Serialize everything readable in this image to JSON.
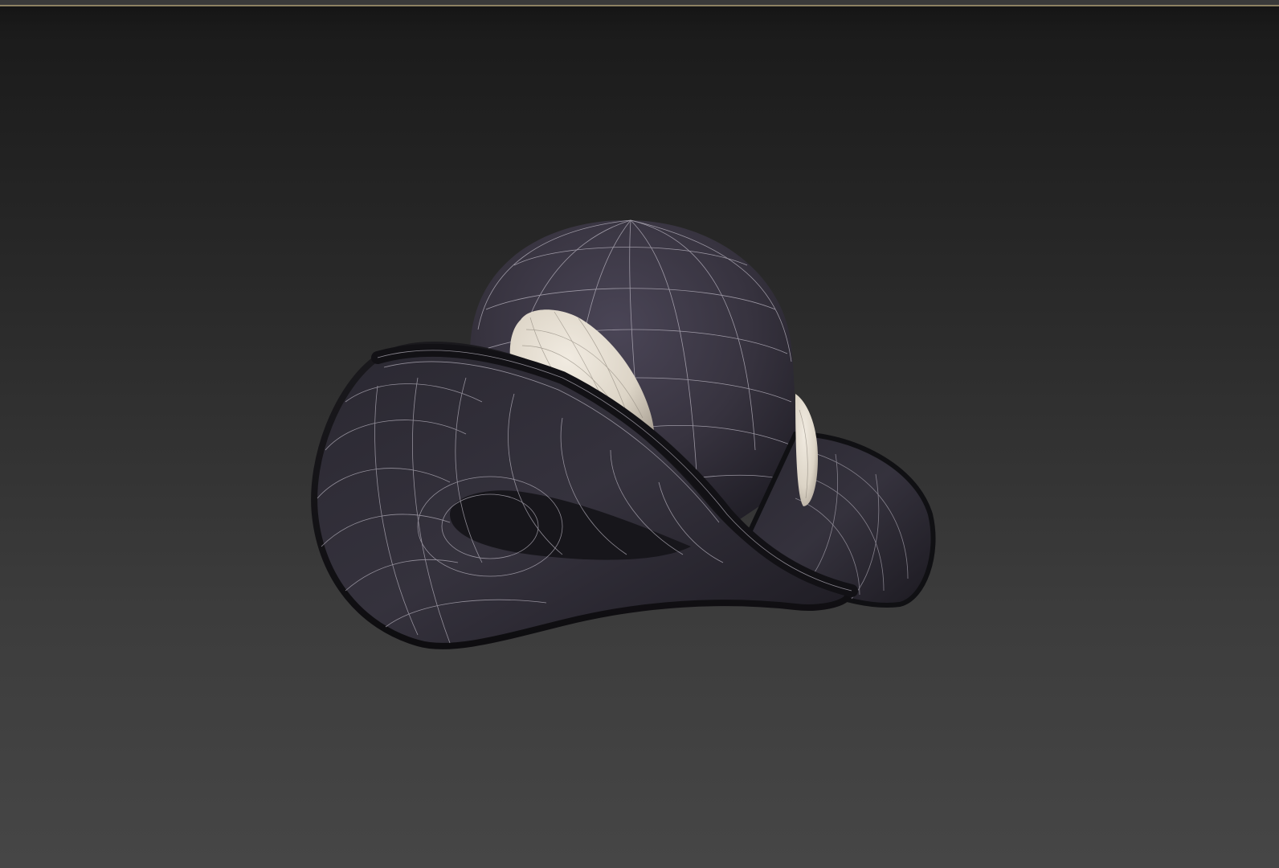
{
  "viewport": {
    "label": "3D viewport",
    "border_color": "#8d8163",
    "background_top": "#141414",
    "background_bottom": "#464646"
  },
  "model": {
    "object": "hat",
    "parts": [
      "crown",
      "brim",
      "crown-ornament"
    ],
    "shading": "wireframe-on-shaded",
    "crown_color": "#3a3644",
    "brim_color": "#2c2a33",
    "ornament_color": "#e6ded2",
    "wire_color": "#bdb8c4"
  }
}
